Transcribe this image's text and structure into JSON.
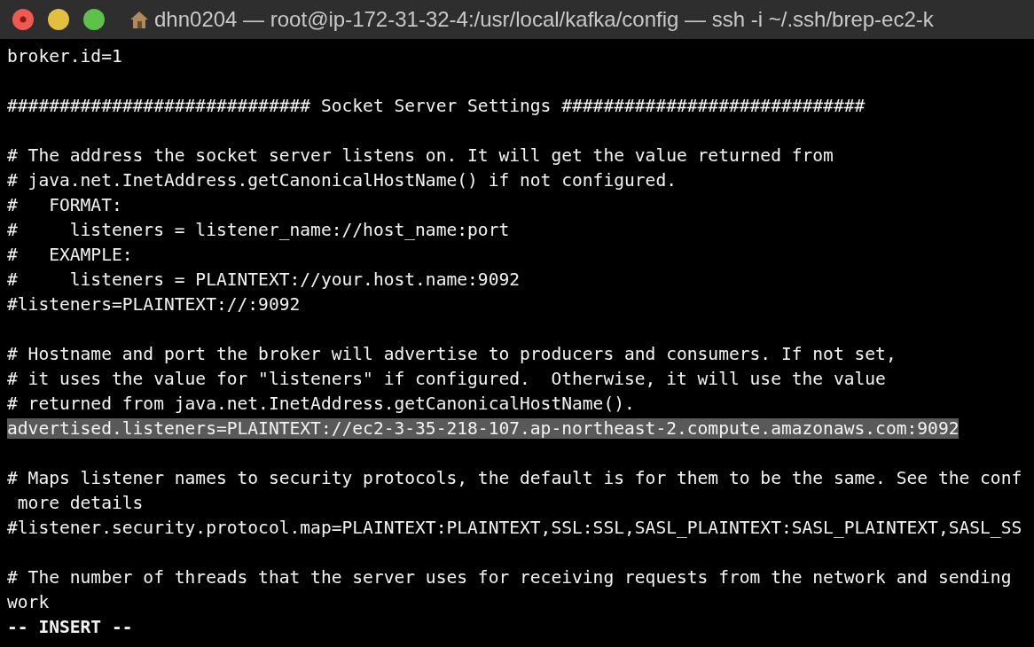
{
  "window": {
    "title": "dhn0204 — root@ip-172-31-32-4:/usr/local/kafka/config — ssh -i ~/.ssh/brep-ec2-k"
  },
  "blocks": [
    [
      {
        "text": "broker.id=1",
        "highlighted": false
      }
    ],
    [
      {
        "text": "############################# Socket Server Settings #############################",
        "highlighted": false
      }
    ],
    [
      {
        "text": "# The address the socket server listens on. It will get the value returned from",
        "highlighted": false
      },
      {
        "text": "# java.net.InetAddress.getCanonicalHostName() if not configured.",
        "highlighted": false
      },
      {
        "text": "#   FORMAT:",
        "highlighted": false
      },
      {
        "text": "#     listeners = listener_name://host_name:port",
        "highlighted": false
      },
      {
        "text": "#   EXAMPLE:",
        "highlighted": false
      },
      {
        "text": "#     listeners = PLAINTEXT://your.host.name:9092",
        "highlighted": false
      },
      {
        "text": "#listeners=PLAINTEXT://:9092",
        "highlighted": false
      }
    ],
    [
      {
        "text": "# Hostname and port the broker will advertise to producers and consumers. If not set,",
        "highlighted": false
      },
      {
        "text": "# it uses the value for \"listeners\" if configured.  Otherwise, it will use the value",
        "highlighted": false
      },
      {
        "text": "# returned from java.net.InetAddress.getCanonicalHostName().",
        "highlighted": false
      },
      {
        "text": "advertised.listeners=PLAINTEXT://ec2-3-35-218-107.ap-northeast-2.compute.amazonaws.com:9092",
        "highlighted": true
      }
    ],
    [
      {
        "text": "# Maps listener names to security protocols, the default is for them to be the same. See the conf",
        "highlighted": false
      },
      {
        "text": " more details",
        "highlighted": false
      },
      {
        "text": "#listener.security.protocol.map=PLAINTEXT:PLAINTEXT,SSL:SSL,SASL_PLAINTEXT:SASL_PLAINTEXT,SASL_SS",
        "highlighted": false
      }
    ],
    [
      {
        "text": "# The number of threads that the server uses for receiving requests from the network and sending",
        "highlighted": false
      },
      {
        "text": "work",
        "highlighted": false
      }
    ]
  ],
  "mode": "-- INSERT --"
}
